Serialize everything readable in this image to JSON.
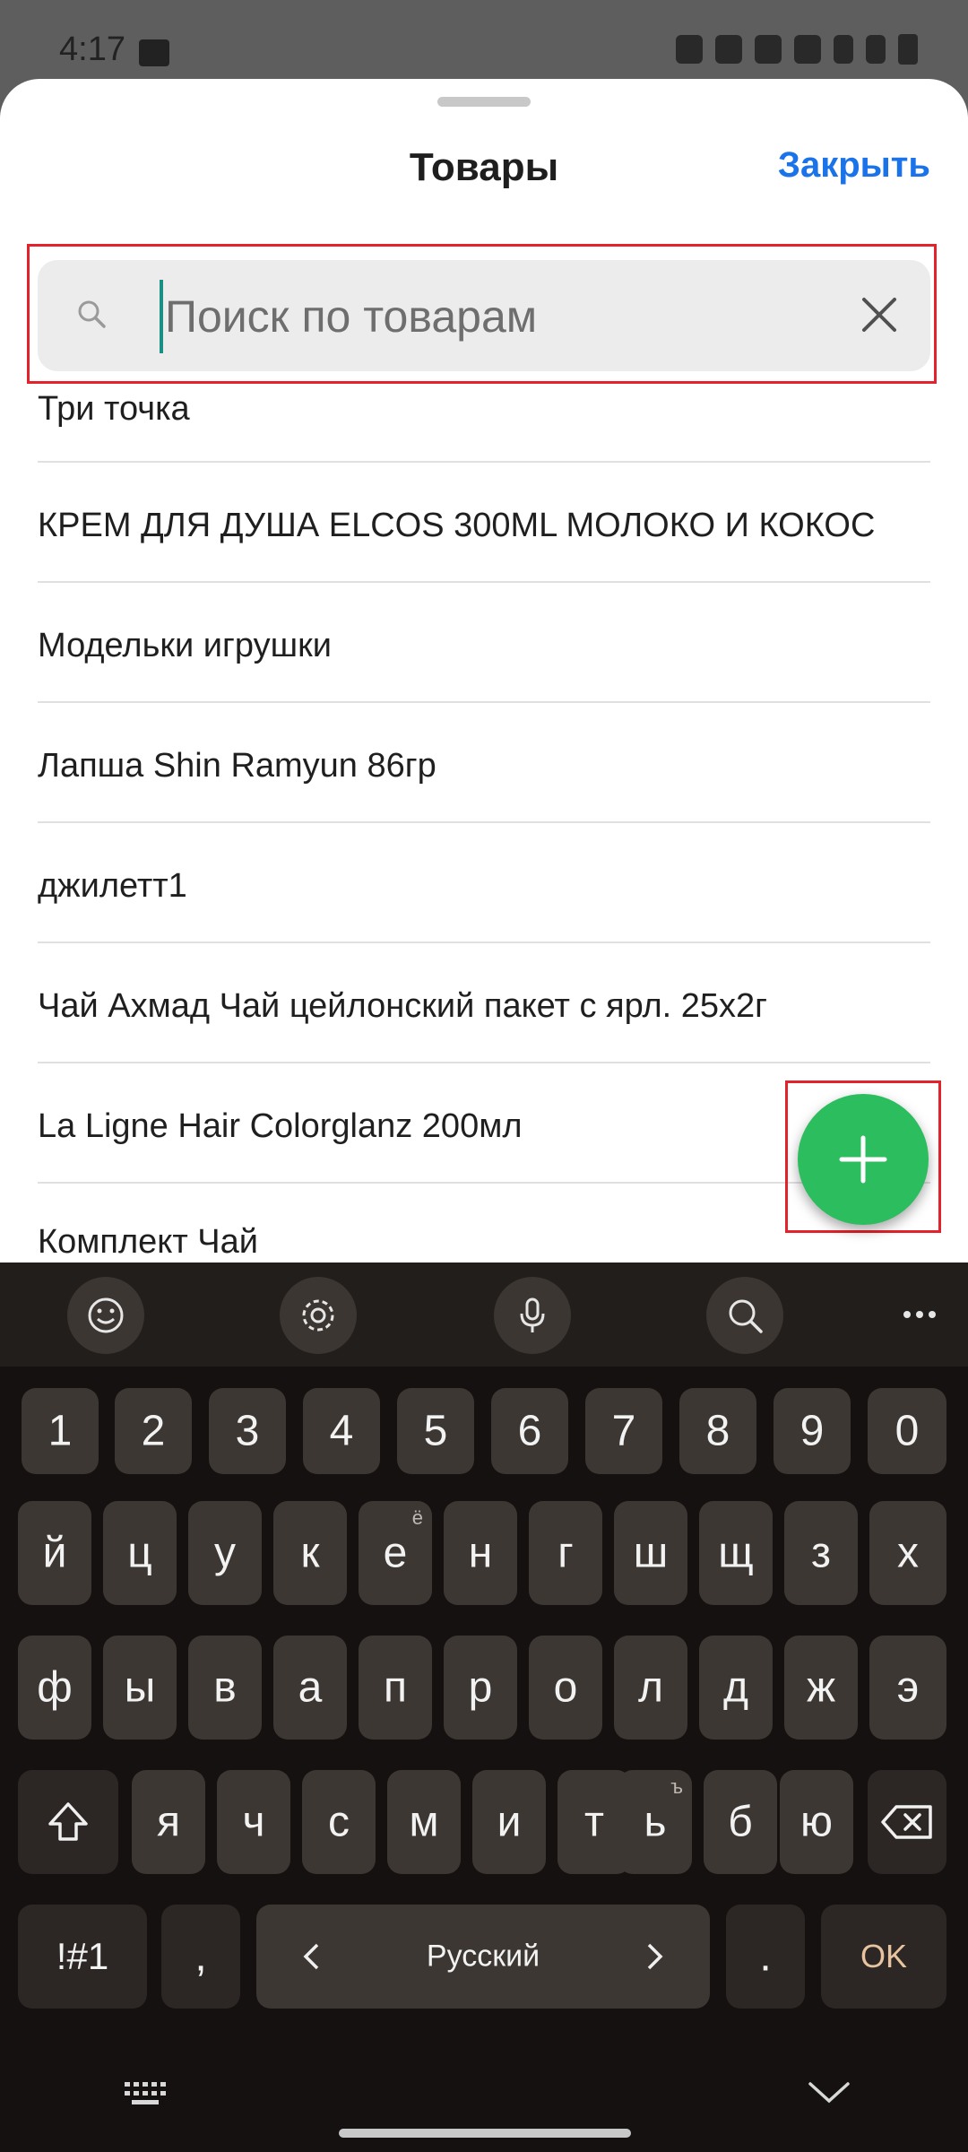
{
  "status_bar": {
    "time": "4:17"
  },
  "sheet": {
    "title": "Товары",
    "close_label": "Закрыть",
    "search": {
      "placeholder": "Поиск по товарам",
      "value": ""
    },
    "items": [
      "Три точка",
      "КРЕМ ДЛЯ ДУША ELCOS 300ML МОЛОКО И КОКОС",
      "Модельки игрушки",
      "Лапша Shin Ramyun 86гр",
      "джилетт1",
      "Чай Ахмад Чай цейлонский пакет с ярл. 25х2г",
      "La Ligne Hair Colorglanz 200мл",
      "Комплект Чай"
    ],
    "fab_icon": "plus-icon"
  },
  "keyboard": {
    "toolbar": [
      "emoji-icon",
      "gear-icon",
      "microphone-icon",
      "search-icon",
      "more-icon"
    ],
    "row_numbers": [
      "1",
      "2",
      "3",
      "4",
      "5",
      "6",
      "7",
      "8",
      "9",
      "0"
    ],
    "row1": [
      "й",
      "ц",
      "у",
      "к",
      "е",
      "н",
      "г",
      "ш",
      "щ",
      "з",
      "х"
    ],
    "row1_sub_e": "ё",
    "row2": [
      "ф",
      "ы",
      "в",
      "а",
      "п",
      "р",
      "о",
      "л",
      "д",
      "ж",
      "э"
    ],
    "row3": [
      "я",
      "ч",
      "с",
      "м",
      "и",
      "т",
      "ь",
      "б",
      "ю"
    ],
    "row3_sub_soft": "ъ",
    "symbols_label": "!#1",
    "comma_label": ",",
    "space_label": "Русский",
    "period_label": ".",
    "ok_label": "OK"
  },
  "colors": {
    "accent": "#1a73e8",
    "fab": "#2bbd5e",
    "highlight": "#e3222b"
  }
}
